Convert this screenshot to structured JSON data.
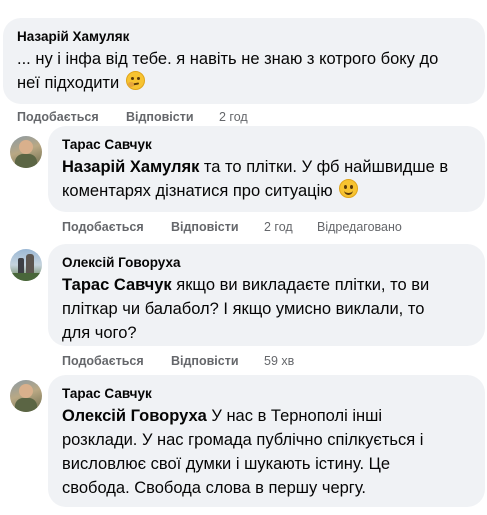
{
  "comments": [
    {
      "author": "Назарій Хамуляк",
      "mention": "",
      "text_lines": [
        "... ну і інфа від тебе. я навіть не знаю з котрого боку до",
        "неї підходити"
      ],
      "emoji": "thinking-face",
      "like_label": "Подобається",
      "reply_label": "Відповісти",
      "time": "2 год",
      "edited": ""
    },
    {
      "author": "Тарас Савчук",
      "mention": "Назарій Хамуляк",
      "text_lines": [
        " та то плітки. У фб найшвидше в",
        "коментарях дізнатися про ситуацію"
      ],
      "emoji": "slightly-smiling-face",
      "like_label": "Подобається",
      "reply_label": "Відповісти",
      "time": "2 год",
      "edited": "Відредаговано"
    },
    {
      "author": "Олексій Говоруха",
      "mention": "Тарас Савчук",
      "text_lines": [
        " якщо ви викладаєте плітки, то ви",
        "пліткар чи балабол? І якщо умисно виклали, то",
        "для чого?"
      ],
      "like_label": "Подобається",
      "reply_label": "Відповісти",
      "time": "59 хв",
      "edited": ""
    },
    {
      "author": "Тарас Савчук",
      "mention": "Олексій Говоруха",
      "text_lines": [
        " У нас в Тернополі інші",
        "розклади. У нас громада публічно спілкується і",
        "висловлює свої думки і шукають істину. Це",
        "свобода. Свобода слова в першу чергу."
      ]
    }
  ],
  "colors": {
    "bubble_bg": "#f0f2f5",
    "meta_text": "#65676b",
    "text": "#050505"
  }
}
